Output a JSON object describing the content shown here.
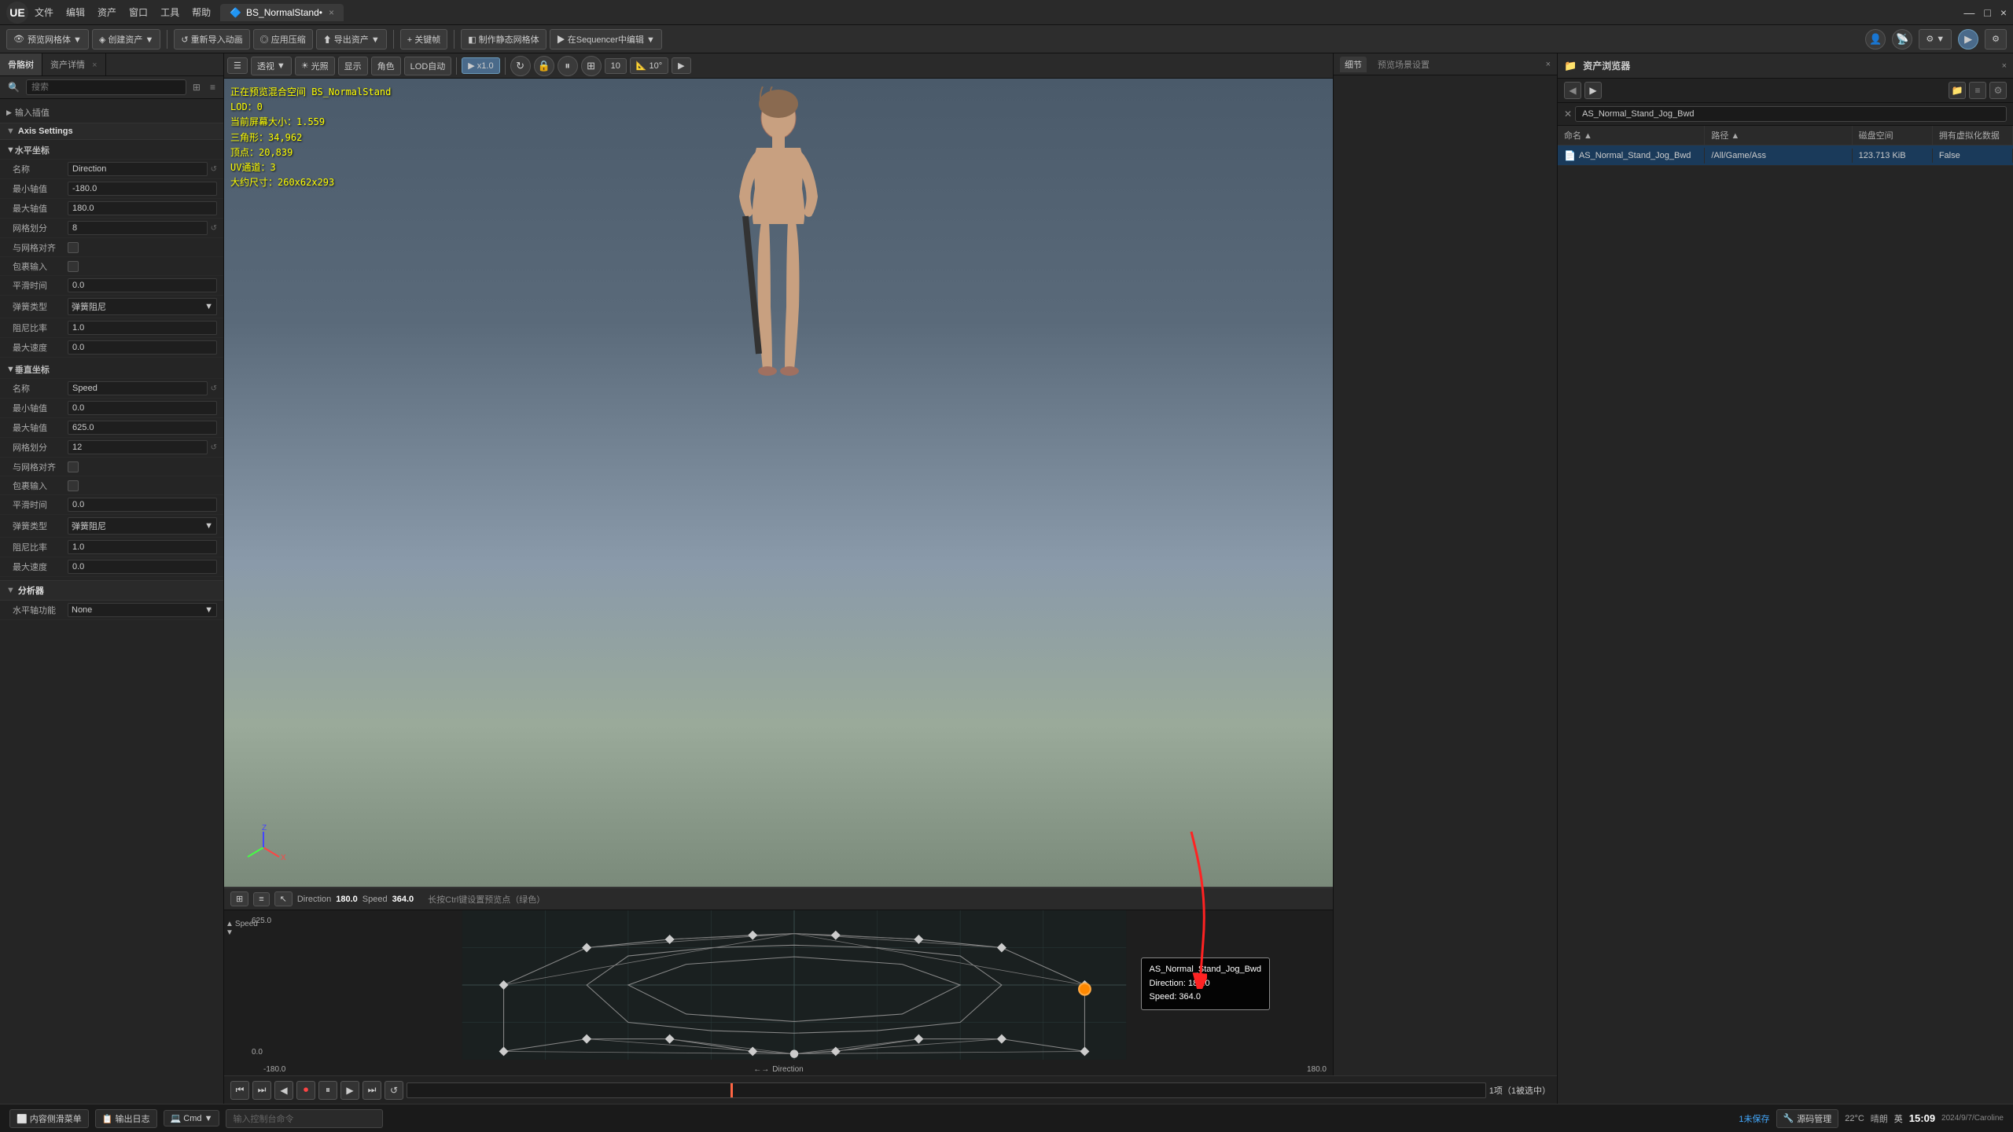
{
  "titlebar": {
    "logo": "UE",
    "menus": [
      "文件",
      "编辑",
      "资产",
      "窗口",
      "工具",
      "帮助"
    ],
    "tab": "BS_NormalStand•",
    "close": "×",
    "minimize": "—",
    "maximize": "□"
  },
  "toolbar": {
    "preview_mesh": "预览网格体 ▼",
    "create_asset": "◈ 创建资产 ▼",
    "reimport": "↺ 重新导入动画",
    "apply_compress": "◎ 应用压缩",
    "export_asset": "⬆ 导出资产 ▼",
    "close_key": "+ 关键帧",
    "make_static": "◧ 制作静态网格体",
    "in_sequencer": "▶ 在Sequencer中编辑 ▼"
  },
  "left_panel": {
    "tab1": "骨骼树",
    "tab2": "资产详情",
    "close_btn": "×",
    "search_placeholder": "搜索",
    "input_section": "输入插值",
    "axis_settings": "Axis Settings",
    "horizontal_axis": {
      "header": "水平坐标",
      "name_label": "名称",
      "name_value": "Direction",
      "min_label": "最小轴值",
      "min_value": "-180.0",
      "max_label": "最大轴值",
      "max_value": "180.0",
      "grid_label": "网格划分",
      "grid_value": "8",
      "grid_snap_label": "与网格对齐",
      "wrap_label": "包裹输入",
      "smooth_label": "平滑时间",
      "smooth_value": "0.0",
      "spring_label": "弹簧类型",
      "spring_value": "弹簧阻尼",
      "damping_label": "阻尼比率",
      "damping_value": "1.0",
      "max_vel_label": "最大速度",
      "max_vel_value": "0.0"
    },
    "vertical_axis": {
      "header": "垂直坐标",
      "name_label": "名称",
      "name_value": "Speed",
      "min_label": "最小轴值",
      "min_value": "0.0",
      "max_label": "最大轴值",
      "max_value": "625.0",
      "grid_label": "网格划分",
      "grid_value": "12",
      "grid_snap_label": "与网格对齐",
      "wrap_label": "包裹输入",
      "smooth_label": "平滑时间",
      "smooth_value": "0.0",
      "spring_label": "弹簧类型",
      "spring_value": "弹簧阻尼",
      "damping_label": "阻尼比率",
      "damping_value": "1.0",
      "max_vel_label": "最大速度",
      "max_vel_value": "0.0"
    },
    "analysis": {
      "header": "分析器",
      "horiz_label": "水平轴功能",
      "horiz_value": "None"
    }
  },
  "viewport": {
    "info_line1": "正在预览混合空间 BS_NormalStand",
    "info_line2": "LOD：0",
    "info_line3": "当前屏幕大小：1.559",
    "info_line4": "三角形：34,962",
    "info_line5": "顶点：20,839",
    "info_line6": "UV通道：3",
    "info_line7": "大约尺寸：260x62x293",
    "toolbar": {
      "menu": "☰",
      "perspective": "透视",
      "lighting": "光照",
      "show": "显示",
      "character": "角色",
      "lod_auto": "LOD自动",
      "play_speed": "▶ x1.0",
      "speed": "▶",
      "rotate": "↻",
      "grid_size": "10",
      "angle": "10°",
      "more": "▶"
    }
  },
  "blend_space": {
    "direction_label": "Direction",
    "speed_label": "Speed",
    "current_direction": "180.0",
    "current_speed": "364.0",
    "y_max": "625.0",
    "y_zero": "0.0",
    "x_min": "-180.0",
    "x_max": "180.0",
    "hint_text": "长按Ctrl键设置预览点（绿色）",
    "tooltip": {
      "name": "AS_Normal_Stand_Jog_Bwd",
      "direction": "Direction: 180.0",
      "speed": "Speed: 364.0"
    }
  },
  "timeline": {
    "controls": [
      "⏮",
      "⏭",
      "◀",
      "⏺",
      "⏸",
      "▶",
      "⏭",
      "↺"
    ],
    "count_label": "1项（1被选中）"
  },
  "inspector": {
    "tab1": "细节",
    "tab2": "预览场景设置",
    "close_btn": "×"
  },
  "asset_browser": {
    "title": "资产浏览器",
    "close": "×",
    "search_placeholder": "AS_Normal_Stand_Jog_Bwd",
    "columns": {
      "name": "命名 ▲",
      "path": "路径 ▲",
      "disk_space": "磁盘空间",
      "virtual_data": "拥有虚拟化数据"
    },
    "rows": [
      {
        "name": "AS_Normal_Stand_Jog_Bwd",
        "path": "/All/Game/Ass",
        "size": "123.713 KiB",
        "virtual": "False",
        "selected": true
      }
    ]
  },
  "status_bar": {
    "buttons": [
      "⬜ 内容侧滑菜单",
      "📋 输出日志",
      "💻 Cmd ▼",
      "输入控制台命令"
    ],
    "temperature": "22°C",
    "weather": "晴朗",
    "language": "英",
    "time": "15:09",
    "date": "2024/9/7/Caroline",
    "unsaved": "1未保存",
    "source": "源码管理"
  },
  "colors": {
    "accent_blue": "#7cb4e0",
    "accent_orange": "#ff6644",
    "selected_row": "#1a3a5a",
    "active_point": "#ff8800",
    "grid_color": "#2a3a3a",
    "bg_dark": "#1a1a1a",
    "bg_medium": "#252525",
    "bg_light": "#2d2d2d"
  }
}
